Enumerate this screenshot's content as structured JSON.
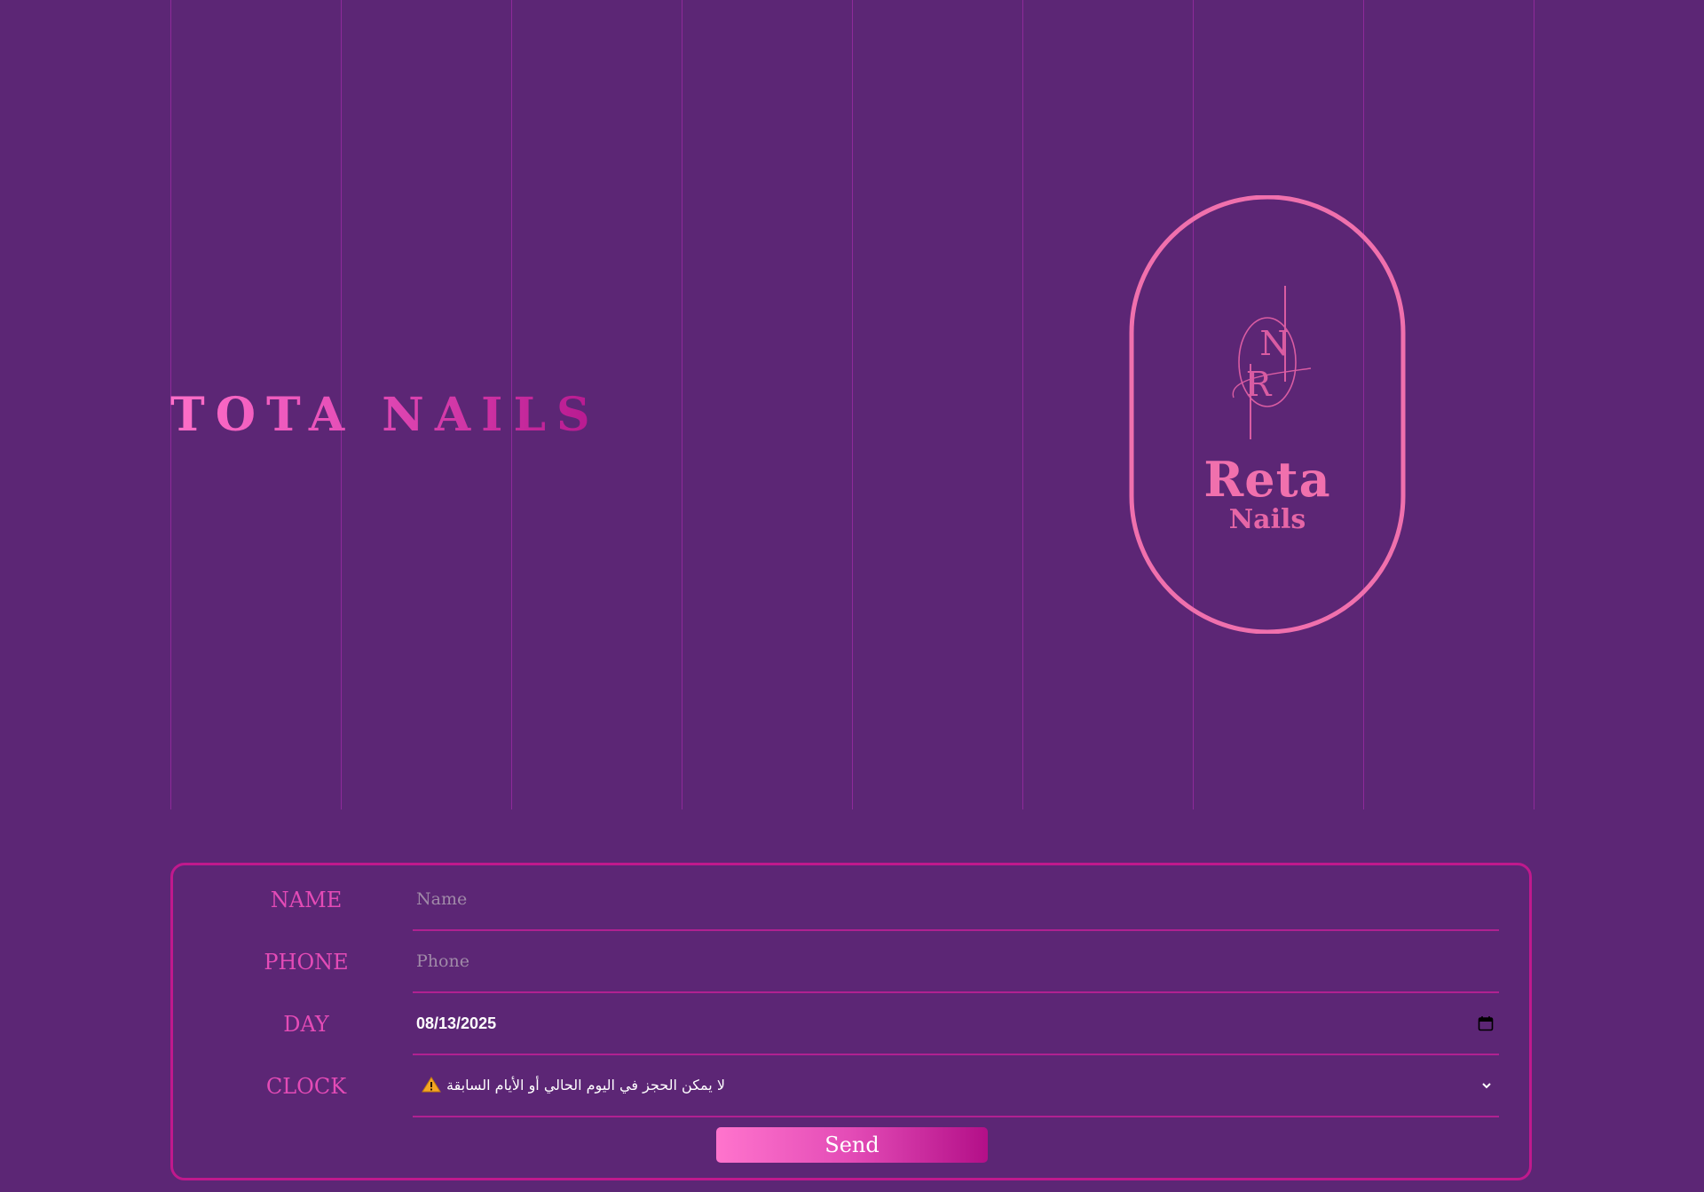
{
  "header": {
    "brand_title": "TOTA NAILS"
  },
  "logo": {
    "name": "Reta",
    "subtitle": "Nails",
    "monogram": "NR"
  },
  "form": {
    "name": {
      "label": "NAME",
      "placeholder": "Name",
      "value": ""
    },
    "phone": {
      "label": "PHONE",
      "placeholder": "Phone",
      "value": ""
    },
    "day": {
      "label": "DAY",
      "value": "08/13/2025"
    },
    "clock": {
      "label": "CLOCK",
      "selected": "لا يمكن الحجز في اليوم الحالي أو الأيام السابقة"
    },
    "send_label": "Send"
  },
  "icons": {
    "calendar": "calendar-icon",
    "warning": "warning-icon",
    "chevron": "chevron-down-icon"
  },
  "colors": {
    "background": "#5c2675",
    "accent_pink": "#e34bb6",
    "border_magenta": "#c0198d",
    "logo_pink": "#f070ad",
    "warning_yellow": "#f5a623"
  }
}
